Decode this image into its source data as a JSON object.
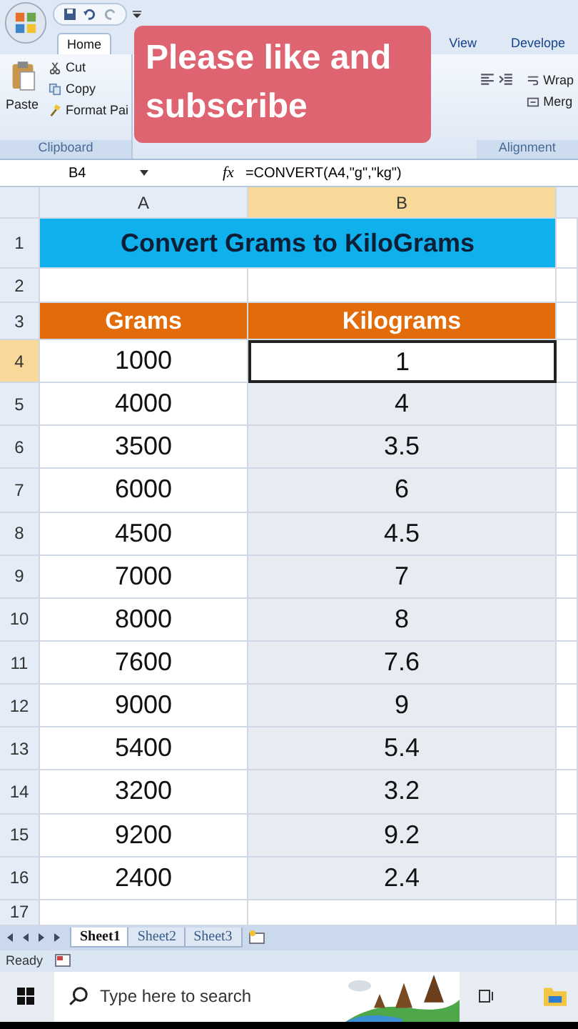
{
  "ribbon_tabs": [
    {
      "label": "Home",
      "selected": true
    },
    {
      "label": "View",
      "selected": false
    },
    {
      "label": "Develope",
      "selected": false
    }
  ],
  "clipboard": {
    "paste": "Paste",
    "cut": "Cut",
    "copy": "Copy",
    "format_painter": "Format Pai",
    "group_label": "Clipboard"
  },
  "alignment": {
    "wrap": "Wrap",
    "merge": "Merg",
    "group_label": "Alignment"
  },
  "overlay_banner": "Please like and subscribe",
  "formula_bar": {
    "name_box": "B4",
    "function_label": "fx",
    "formula": "=CONVERT(A4,\"g\",\"kg\")"
  },
  "columns": [
    {
      "label": "A",
      "selected": false
    },
    {
      "label": "B",
      "selected": true
    }
  ],
  "title_row": {
    "number": "1",
    "text": "Convert Grams to KiloGrams"
  },
  "blank_row": {
    "number": "2"
  },
  "header_row": {
    "number": "3",
    "headers": [
      "Grams",
      "Kilograms"
    ]
  },
  "rows": [
    {
      "number": "4",
      "grams": "1000",
      "kilograms": "1",
      "selected": true
    },
    {
      "number": "5",
      "grams": "4000",
      "kilograms": "4",
      "selected": false
    },
    {
      "number": "6",
      "grams": "3500",
      "kilograms": "3.5",
      "selected": false
    },
    {
      "number": "7",
      "grams": "6000",
      "kilograms": "6",
      "selected": false
    },
    {
      "number": "8",
      "grams": "4500",
      "kilograms": "4.5",
      "selected": false
    },
    {
      "number": "9",
      "grams": "7000",
      "kilograms": "7",
      "selected": false
    },
    {
      "number": "10",
      "grams": "8000",
      "kilograms": "8",
      "selected": false
    },
    {
      "number": "11",
      "grams": "7600",
      "kilograms": "7.6",
      "selected": false
    },
    {
      "number": "12",
      "grams": "9000",
      "kilograms": "9",
      "selected": false
    },
    {
      "number": "13",
      "grams": "5400",
      "kilograms": "5.4",
      "selected": false
    },
    {
      "number": "14",
      "grams": "3200",
      "kilograms": "3.2",
      "selected": false
    },
    {
      "number": "15",
      "grams": "9200",
      "kilograms": "9.2",
      "selected": false
    },
    {
      "number": "16",
      "grams": "2400",
      "kilograms": "2.4",
      "selected": false
    }
  ],
  "last_row": {
    "number": "17"
  },
  "sheet_tabs": [
    {
      "label": "Sheet1",
      "selected": true
    },
    {
      "label": "Sheet2",
      "selected": false
    },
    {
      "label": "Sheet3",
      "selected": false
    }
  ],
  "status": "Ready",
  "taskbar": {
    "search_placeholder": "Type here to search"
  }
}
